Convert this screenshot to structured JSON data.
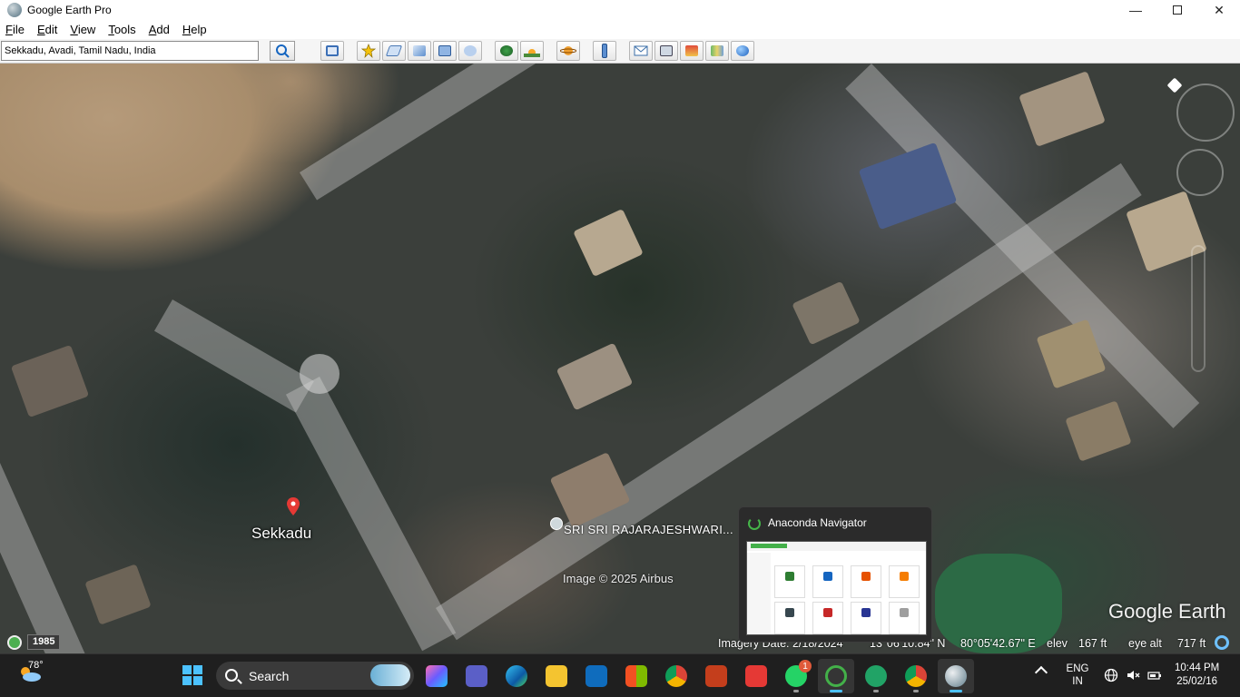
{
  "window": {
    "title": "Google Earth Pro",
    "minimize": "—",
    "close": "✕"
  },
  "menu": {
    "items": [
      "File",
      "Edit",
      "View",
      "Tools",
      "Add",
      "Help"
    ]
  },
  "search": {
    "value": "Sekkadu, Avadi, Tamil Nadu, India"
  },
  "map": {
    "placemark_label": "Sekkadu",
    "poi_label": "SRI SRI RAJARAJESHWARI...",
    "copyright": "Image © 2025 Airbus",
    "logo": "Google Earth",
    "historical_year": "1985"
  },
  "status": {
    "imagery_date": "Imagery Date: 2/18/2024",
    "lat": "13°06'10.84\" N",
    "lon": "80°05'42.67\" E",
    "elev_label": "elev",
    "elev_value": "167 ft",
    "eye_label": "eye alt",
    "eye_value": "717 ft"
  },
  "preview": {
    "title": "Anaconda Navigator"
  },
  "taskbar": {
    "weather_temp": "78°",
    "search_label": "Search",
    "whatsapp_badge": "1",
    "lang_top": "ENG",
    "lang_bottom": "IN",
    "time": "10:44 PM",
    "date": "25/02/16"
  },
  "colors": {
    "accent": "#4cc2ff",
    "anaconda_green": "#43b049",
    "placemark": "#e53935"
  }
}
